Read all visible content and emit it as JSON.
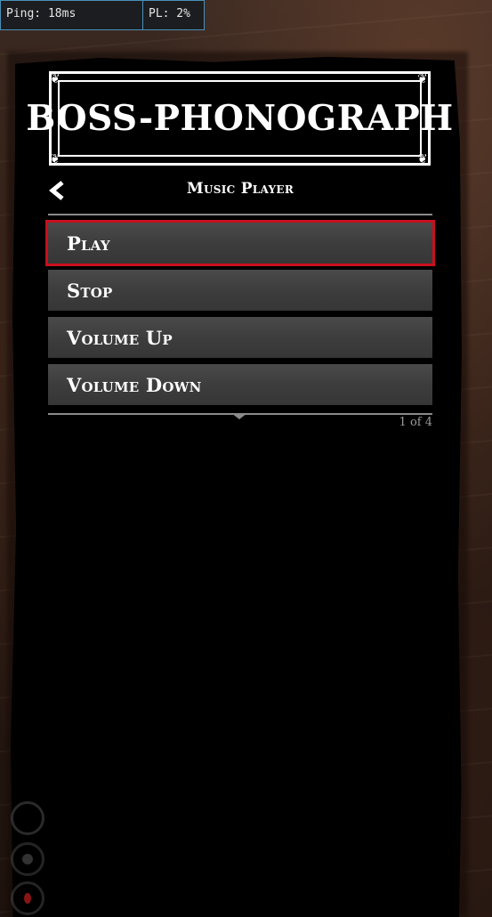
{
  "debug": {
    "ping": "Ping: 18ms",
    "pl": "PL: 2%"
  },
  "menu": {
    "title": "BOSS-PHONOGRAPH",
    "subtitle": "Music Player",
    "back_icon": "chevron-left-icon",
    "items": [
      {
        "label": "Play",
        "selected": true
      },
      {
        "label": "Stop",
        "selected": false
      },
      {
        "label": "Volume Up",
        "selected": false
      },
      {
        "label": "Volume Down",
        "selected": false
      }
    ],
    "page_count": "1 of 4"
  },
  "hud": {
    "icons": [
      "stamina-icon",
      "health-icon",
      "dead-eye-icon"
    ]
  },
  "colors": {
    "selection": "#c8101c",
    "item_bg": "#3d3d3d",
    "panel_bg": "#000000"
  }
}
